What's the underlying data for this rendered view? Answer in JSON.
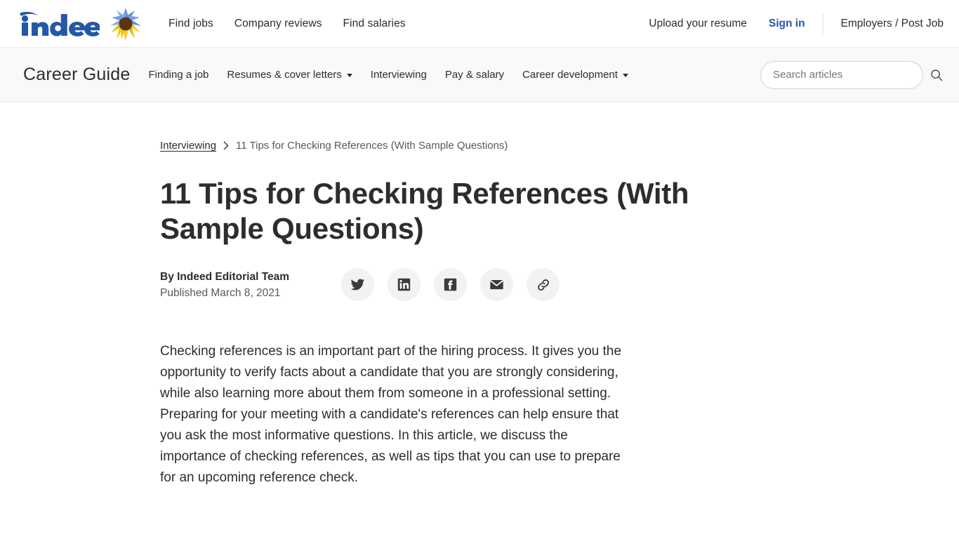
{
  "header": {
    "logo_text": "indeed",
    "logo_icon": "sunflower-icon",
    "nav": [
      {
        "label": "Find jobs"
      },
      {
        "label": "Company reviews"
      },
      {
        "label": "Find salaries"
      }
    ],
    "upload_resume": "Upload your resume",
    "sign_in": "Sign in",
    "employers": "Employers / Post Job",
    "accent_color": "#2557a7"
  },
  "guidebar": {
    "title": "Career Guide",
    "nav": [
      {
        "label": "Finding a job",
        "has_dropdown": false
      },
      {
        "label": "Resumes & cover letters",
        "has_dropdown": true
      },
      {
        "label": "Interviewing",
        "has_dropdown": false
      },
      {
        "label": "Pay & salary",
        "has_dropdown": false
      },
      {
        "label": "Career development",
        "has_dropdown": true
      }
    ],
    "search": {
      "placeholder": "Search articles",
      "value": "",
      "icon": "search-icon"
    },
    "background_color": "#faf9f8"
  },
  "breadcrumb": {
    "parent": "Interviewing",
    "separator": "›",
    "current": "11 Tips for Checking References (With Sample Questions)"
  },
  "article": {
    "title": "11 Tips for Checking References (With Sample Questions)",
    "author": "By Indeed Editorial Team",
    "published": "Published March 8, 2021",
    "share": [
      {
        "name": "twitter",
        "label": "Share on Twitter"
      },
      {
        "name": "linkedin",
        "label": "Share on LinkedIn"
      },
      {
        "name": "facebook",
        "label": "Share on Facebook"
      },
      {
        "name": "email",
        "label": "Share by email"
      },
      {
        "name": "link",
        "label": "Copy link"
      }
    ],
    "intro_paragraph": "Checking references is an important part of the hiring process. It gives you the opportunity to verify facts about a candidate that you are strongly considering, while also learning more about them from someone in a professional setting. Preparing for your meeting with a candidate's references can help ensure that you ask the most informative questions. In this article, we discuss the importance of checking references, as well as tips that you can use to prepare for an upcoming reference check."
  }
}
